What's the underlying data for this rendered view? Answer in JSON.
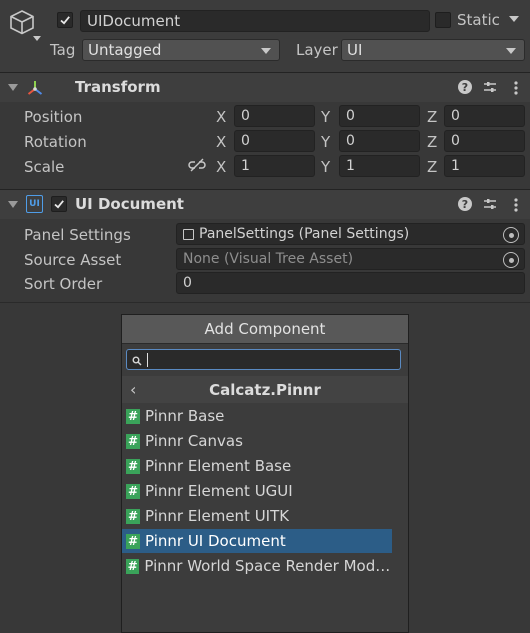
{
  "gameobject": {
    "name": "UIDocument",
    "active": true,
    "static_label": "Static",
    "static_checked": false,
    "tag_label": "Tag",
    "tag_value": "Untagged",
    "layer_label": "Layer",
    "layer_value": "UI"
  },
  "transform": {
    "title": "Transform",
    "rows": [
      {
        "label": "Position",
        "x": "0",
        "y": "0",
        "z": "0"
      },
      {
        "label": "Rotation",
        "x": "0",
        "y": "0",
        "z": "0"
      },
      {
        "label": "Scale",
        "x": "1",
        "y": "1",
        "z": "1"
      }
    ],
    "axis": {
      "x": "X",
      "y": "Y",
      "z": "Z"
    }
  },
  "ui_document": {
    "title": "UI Document",
    "icon_text": "UI",
    "enabled": true,
    "rows": [
      {
        "label": "Panel Settings",
        "value": "PanelSettings (Panel Settings)"
      },
      {
        "label": "Source Asset",
        "value": "None (Visual Tree Asset)"
      },
      {
        "label": "Sort Order",
        "value": "0"
      }
    ]
  },
  "add_component": {
    "button_label": "Add Component",
    "search_value": "",
    "category": "Calcatz.Pinnr",
    "items": [
      {
        "label": "Pinnr Base",
        "selected": false
      },
      {
        "label": "Pinnr Canvas",
        "selected": false
      },
      {
        "label": "Pinnr Element Base",
        "selected": false
      },
      {
        "label": "Pinnr Element UGUI",
        "selected": false
      },
      {
        "label": "Pinnr Element UITK",
        "selected": false
      },
      {
        "label": "Pinnr UI Document",
        "selected": true
      },
      {
        "label": "Pinnr World Space Render Mode ...",
        "selected": false
      }
    ]
  },
  "colors": {
    "selection": "#2c5d87",
    "script_icon": "#3aa35a",
    "search_focus": "#5a8ac2"
  }
}
